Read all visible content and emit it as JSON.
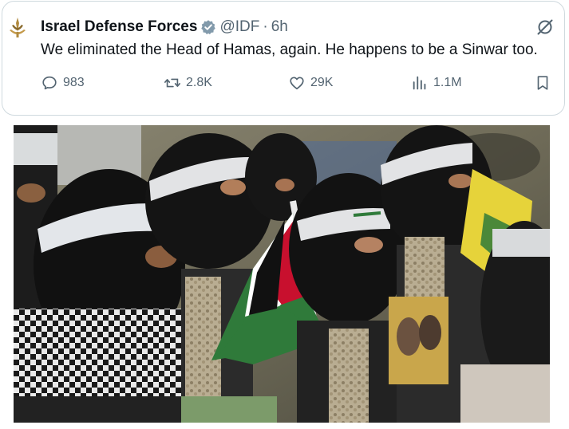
{
  "tweet": {
    "author_name": "Israel Defense Forces",
    "handle": "@IDF",
    "separator": "·",
    "time": "6h",
    "text": "We eliminated the Head of Hamas, again. He happens to be a Sinwar too.",
    "icons": {
      "avatar": "idf-emblem-icon",
      "verified": "verified-badge-icon",
      "grok": "grok-icon",
      "reply": "reply-icon",
      "retweet": "retweet-icon",
      "like": "heart-icon",
      "views": "views-bar-chart-icon",
      "bookmark": "bookmark-icon"
    },
    "stats": {
      "replies": "983",
      "reposts": "2.8K",
      "likes": "29K",
      "views": "1.1M"
    }
  },
  "colors": {
    "text_primary": "#0f1419",
    "text_secondary": "#536471",
    "border": "#cfd9de",
    "verified_badge": "#829aab",
    "flag_red": "#c8102e",
    "flag_green": "#2f7a3a",
    "headband_yellow": "#e6d33a"
  }
}
